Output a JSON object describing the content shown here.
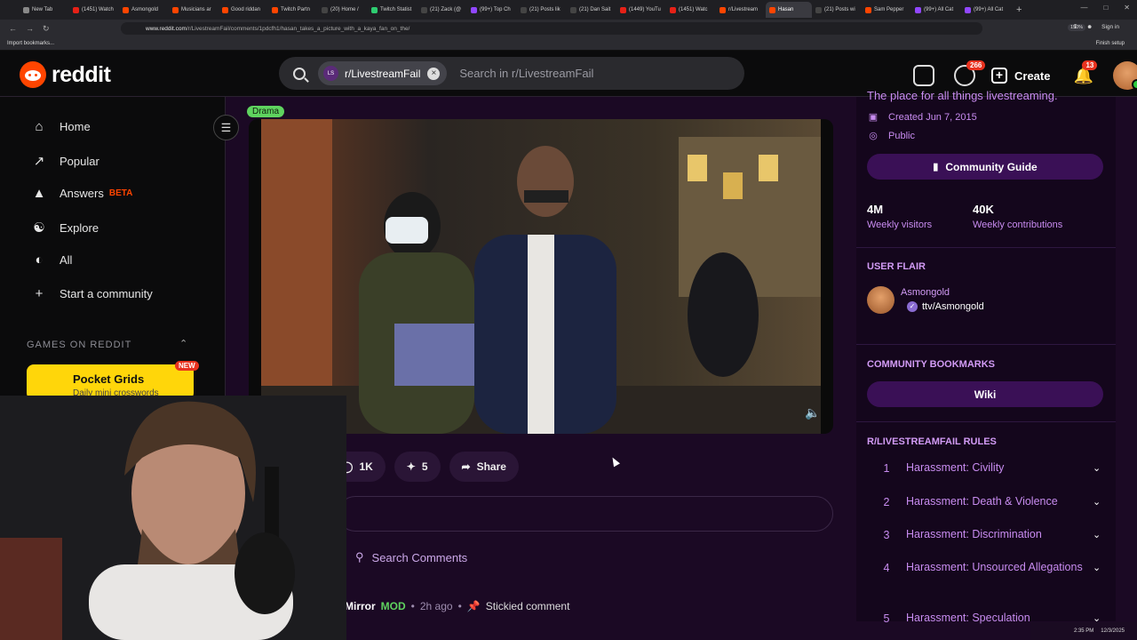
{
  "browser": {
    "tabs": [
      {
        "label": "New Tab",
        "color": "#888888"
      },
      {
        "label": "(1451) Watch",
        "color": "#e62117"
      },
      {
        "label": "Asmongold",
        "color": "#ff4500"
      },
      {
        "label": "Musicians ar",
        "color": "#ff4500"
      },
      {
        "label": "Good riddan",
        "color": "#ff4500"
      },
      {
        "label": "Twitch Partn",
        "color": "#ff4500"
      },
      {
        "label": "(20) Home /",
        "color": "#444444"
      },
      {
        "label": "Twitch Statist",
        "color": "#2ecc71"
      },
      {
        "label": "(21) Zack (@",
        "color": "#444444"
      },
      {
        "label": "(99+) Top Ch",
        "color": "#9147ff"
      },
      {
        "label": "(21) Posts lik",
        "color": "#444444"
      },
      {
        "label": "(21) Dan Sait",
        "color": "#444444"
      },
      {
        "label": "(1449) YouTu",
        "color": "#e62117"
      },
      {
        "label": "(1451) Watc",
        "color": "#e62117"
      },
      {
        "label": "r/Livestream",
        "color": "#ff4500"
      },
      {
        "label": "Hasan",
        "color": "#ff4500",
        "active": true
      },
      {
        "label": "(21) Posts wi",
        "color": "#444444"
      },
      {
        "label": "Sam Pepper",
        "color": "#ff4500"
      },
      {
        "label": "(99+) All Cat",
        "color": "#9147ff"
      },
      {
        "label": "(99+) All Cat",
        "color": "#9147ff"
      }
    ],
    "url_host": "www.reddit.com",
    "url_path": "/r/LivestreamFail/comments/1pdcfh1/hasan_takes_a_picture_with_a_kaya_fan_on_the/",
    "zoom": "150%",
    "sign_in": "Sign in",
    "bookmarks_label": "Import bookmarks...",
    "finish_setup": "Finish setup"
  },
  "header": {
    "wordmark": "reddit",
    "community_chip": "r/LivestreamFail",
    "community_abbr": "LS",
    "search_placeholder": "Search in r/LivestreamFail",
    "chat_badge": "266",
    "create_label": "Create",
    "notif_badge": "13"
  },
  "sidebar": {
    "items": [
      {
        "label": "Home",
        "icon": "home-icon"
      },
      {
        "label": "Popular",
        "icon": "popular-icon"
      },
      {
        "label": "Answers",
        "icon": "answers-icon",
        "badge": "BETA"
      },
      {
        "label": "Explore",
        "icon": "explore-icon"
      },
      {
        "label": "All",
        "icon": "all-icon"
      },
      {
        "label": "Start a community",
        "icon": "plus-icon"
      }
    ],
    "games_heading": "GAMES ON REDDIT",
    "game": {
      "title": "Pocket Grids",
      "subtitle": "Daily mini crosswords",
      "badge": "NEW"
    }
  },
  "post": {
    "flair": "Drama",
    "upvotes": "1K",
    "awards": "5",
    "share": "Share",
    "search_comments": "Search Comments",
    "comment": {
      "user": "Mirror",
      "role": "MOD",
      "time": "2h ago",
      "note": "Stickied comment"
    }
  },
  "community": {
    "description": "The place for all things livestreaming.",
    "created": "Created Jun 7, 2015",
    "visibility": "Public",
    "guide_button": "Community Guide",
    "visitors_value": "4M",
    "visitors_label": "Weekly visitors",
    "contrib_value": "40K",
    "contrib_label": "Weekly contributions",
    "user_flair_heading": "USER FLAIR",
    "user_name": "Asmongold",
    "user_flair": "ttv/Asmongold",
    "bookmarks_heading": "COMMUNITY BOOKMARKS",
    "wiki_button": "Wiki",
    "rules_heading": "R/LIVESTREAMFAIL RULES",
    "rules": [
      {
        "num": "1",
        "text": "Harassment: Civility"
      },
      {
        "num": "2",
        "text": "Harassment: Death & Violence"
      },
      {
        "num": "3",
        "text": "Harassment: Discrimination"
      },
      {
        "num": "4",
        "text": "Harassment: Unsourced Allegations"
      },
      {
        "num": "5",
        "text": "Harassment: Speculation"
      }
    ]
  },
  "tray": {
    "time": "2:35 PM",
    "date": "12/3/2025"
  },
  "colors": {
    "accent": "#ff4500",
    "purple_text": "#c88cf0",
    "flair_green": "#5fd35f"
  }
}
